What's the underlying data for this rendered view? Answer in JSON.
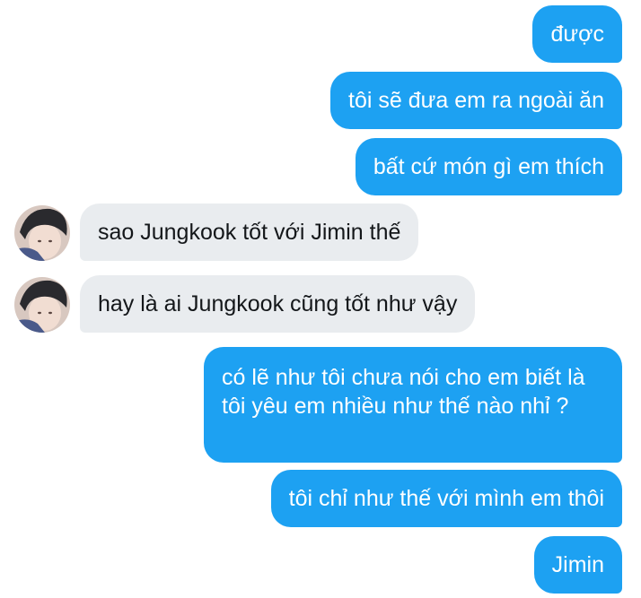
{
  "conversation": {
    "messages": [
      {
        "side": "outgoing",
        "text": "được"
      },
      {
        "side": "outgoing",
        "text": "tôi sẽ đưa em ra ngoài ăn"
      },
      {
        "side": "outgoing",
        "text": "bất cứ món gì em thích"
      },
      {
        "side": "incoming",
        "text": "sao Jungkook tốt với Jimin thế"
      },
      {
        "side": "incoming",
        "text": "hay là ai Jungkook cũng tốt như vậy"
      },
      {
        "side": "outgoing",
        "text": "có lẽ như tôi chưa nói cho em biết là tôi yêu em nhiều như thế nào nhỉ ?"
      },
      {
        "side": "outgoing",
        "text": "tôi chỉ như thế với mình em thôi"
      },
      {
        "side": "outgoing",
        "text": "Jimin"
      }
    ]
  },
  "colors": {
    "outgoing_bubble": "#1da1f2",
    "incoming_bubble": "#e9ecef",
    "outgoing_text": "#ffffff",
    "incoming_text": "#14171a"
  },
  "icons": {
    "avatar": "avatar-photo"
  }
}
